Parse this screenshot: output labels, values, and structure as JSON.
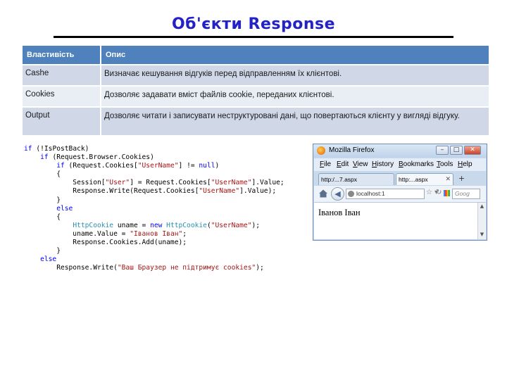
{
  "title": "Об'єкти Response",
  "table": {
    "headers": [
      "Властивість",
      "Опис"
    ],
    "rows": [
      {
        "name": "Cashe",
        "desc": "Визначає кешування відгуків перед відправленням їх клієнтові."
      },
      {
        "name": "Cookies",
        "desc": "Дозволяє задавати вміст файлів cookie, переданих клієнтові."
      },
      {
        "name": "Output",
        "desc": "Дозволяє читати і записувати неструктуровані дані, що повертаються клієнту у вигляді відгуку."
      }
    ]
  },
  "code": {
    "lines": [
      [
        {
          "t": "if",
          "c": "kw"
        },
        {
          "t": " (!IsPostBack)",
          "c": "pl"
        }
      ],
      [
        {
          "t": "    ",
          "c": "pl"
        },
        {
          "t": "if",
          "c": "kw"
        },
        {
          "t": " (Request.Browser.Cookies)",
          "c": "pl"
        }
      ],
      [
        {
          "t": "        ",
          "c": "pl"
        },
        {
          "t": "if",
          "c": "kw"
        },
        {
          "t": " (Request.Cookies[",
          "c": "pl"
        },
        {
          "t": "\"UserName\"",
          "c": "st"
        },
        {
          "t": "] != ",
          "c": "pl"
        },
        {
          "t": "null",
          "c": "kw"
        },
        {
          "t": ")",
          "c": "pl"
        }
      ],
      [
        {
          "t": "        {",
          "c": "pl"
        }
      ],
      [
        {
          "t": "            Session[",
          "c": "pl"
        },
        {
          "t": "\"User\"",
          "c": "st"
        },
        {
          "t": "] = Request.Cookies[",
          "c": "pl"
        },
        {
          "t": "\"UserName\"",
          "c": "st"
        },
        {
          "t": "].Value;",
          "c": "pl"
        }
      ],
      [
        {
          "t": "            Response.Write(Request.Cookies[",
          "c": "pl"
        },
        {
          "t": "\"UserName\"",
          "c": "st"
        },
        {
          "t": "].Value);",
          "c": "pl"
        }
      ],
      [
        {
          "t": "        }",
          "c": "pl"
        }
      ],
      [
        {
          "t": "        ",
          "c": "pl"
        },
        {
          "t": "else",
          "c": "kw"
        }
      ],
      [
        {
          "t": "        {",
          "c": "pl"
        }
      ],
      [
        {
          "t": "            ",
          "c": "pl"
        },
        {
          "t": "HttpCookie",
          "c": "ty"
        },
        {
          "t": " uname = ",
          "c": "pl"
        },
        {
          "t": "new",
          "c": "kw"
        },
        {
          "t": " ",
          "c": "pl"
        },
        {
          "t": "HttpCookie",
          "c": "ty"
        },
        {
          "t": "(",
          "c": "pl"
        },
        {
          "t": "\"UserName\"",
          "c": "st"
        },
        {
          "t": ");",
          "c": "pl"
        }
      ],
      [
        {
          "t": "            uname.Value = ",
          "c": "pl"
        },
        {
          "t": "\"Іванов Іван\"",
          "c": "st"
        },
        {
          "t": ";",
          "c": "pl"
        }
      ],
      [
        {
          "t": "            Response.Cookies.Add(uname);",
          "c": "pl"
        }
      ],
      [
        {
          "t": "        }",
          "c": "pl"
        }
      ],
      [
        {
          "t": "    ",
          "c": "pl"
        },
        {
          "t": "else",
          "c": "kw"
        }
      ],
      [
        {
          "t": "        Response.Write(",
          "c": "pl"
        },
        {
          "t": "\"Ваш Браузер не підтримує cookies\"",
          "c": "st"
        },
        {
          "t": ");",
          "c": "pl"
        }
      ]
    ]
  },
  "browser": {
    "window_title": "Mozilla Firefox",
    "buttons": {
      "minimize": "–",
      "maximize": "□",
      "close": "✕"
    },
    "menu": [
      "File",
      "Edit",
      "View",
      "History",
      "Bookmarks",
      "Tools",
      "Help"
    ],
    "tabs": [
      {
        "label": "http:/...7.aspx",
        "active": false
      },
      {
        "label": "http:...aspx",
        "active": true
      }
    ],
    "new_tab": "+",
    "url": "localhost:1",
    "search_placeholder": "Goog",
    "page_text": "Іванов Іван",
    "icons": [
      "firefox-logo",
      "home-icon",
      "back-icon",
      "star-icon",
      "reload-icon",
      "google-icon"
    ]
  }
}
